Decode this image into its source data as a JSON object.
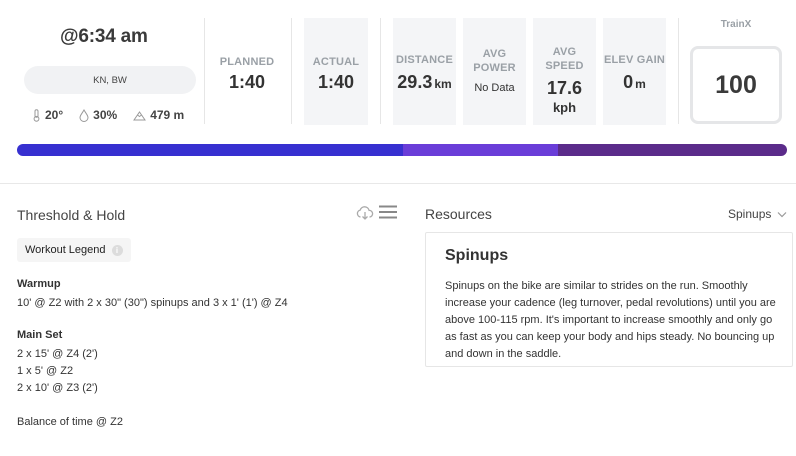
{
  "header": {
    "time": "@6:34 am",
    "location": "KN, BW",
    "weather": {
      "temperature": "20°",
      "humidity": "30%",
      "elevation": "479 m"
    },
    "metrics": [
      {
        "id": "planned",
        "label": "PLANNED",
        "value": "1:40"
      },
      {
        "id": "actual",
        "label": "ACTUAL",
        "value": "1:40"
      },
      {
        "id": "distance",
        "label": "DISTANCE",
        "value": "29.3",
        "unit": "km"
      },
      {
        "id": "avg_power",
        "label_line1": "AVG",
        "label_line2": "POWER",
        "value": "No Data"
      },
      {
        "id": "avg_speed",
        "label": "AVG SPEED",
        "value": "17.6",
        "unit": "kph"
      },
      {
        "id": "elev_gain",
        "label": "ELEV GAIN",
        "value": "0",
        "unit": "m"
      }
    ],
    "trainx": {
      "label": "TrainX",
      "score": "100"
    }
  },
  "zone_bar": {
    "segments": [
      {
        "share": 0.501,
        "color": "#3730d0"
      },
      {
        "share": 0.201,
        "color": "#6a3dd8"
      },
      {
        "share": 0.298,
        "color": "#5b2b8a"
      }
    ]
  },
  "workout": {
    "title": "Threshold & Hold",
    "legend_label": "Workout Legend",
    "info_glyph": "i",
    "warmup_heading": "Warmup",
    "warmup_text": "10' @ Z2 with 2 x 30\" (30\") spinups and 3 x 1' (1') @ Z4",
    "main_heading": "Main Set",
    "main_lines": [
      "2 x 15' @ Z4 (2')",
      "1 x 5' @ Z2",
      "2 x 10' @ Z3 (2')"
    ],
    "balance_text": "Balance of time @ Z2"
  },
  "resources": {
    "title": "Resources",
    "selected": "Spinups",
    "card_title": "Spinups",
    "card_body": "Spinups on the bike are similar to strides on the run. Smoothly increase your cadence (leg turnover, pedal revolutions) until you are above 100-115 rpm. It's important to increase smoothly and only go as fast as you can keep your body and hips steady. No bouncing up and down in the saddle."
  },
  "icons": {
    "thermometer": "thermometer-icon",
    "humidity": "humidity-drop-icon",
    "elevation": "mountain-icon",
    "download": "cloud-download-icon",
    "menu": "hamburger-menu-icon",
    "info": "info-icon",
    "dropdown": "chevron-down-icon"
  }
}
